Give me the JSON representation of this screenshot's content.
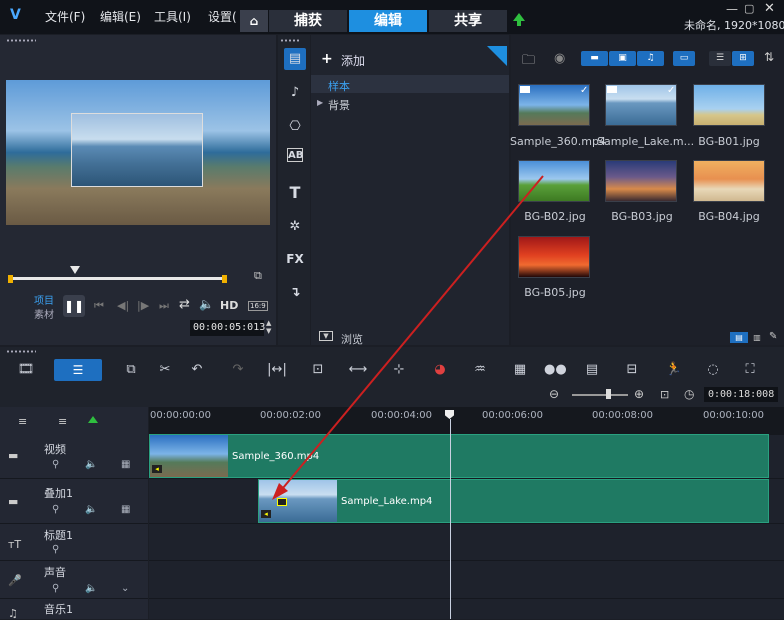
{
  "menu": {
    "file": "文件(F)",
    "edit": "编辑(E)",
    "tools": "工具(I)",
    "settings": "设置(S)"
  },
  "tabs": {
    "capture": "捕获",
    "edit": "编辑",
    "share": "共享"
  },
  "project_info": "未命名, 1920*1080",
  "player": {
    "project_label": "项目",
    "material_label": "素材",
    "hd_label": "HD",
    "aspect_label": "16:9",
    "timecode": "00:00:05:013"
  },
  "library": {
    "add_label": "添加",
    "tree": [
      "样本",
      "背景"
    ],
    "browse_label": "浏览",
    "media": [
      {
        "name": "Sample_360.mp4",
        "checked": true
      },
      {
        "name": "Sample_Lake.m...",
        "checked": true
      },
      {
        "name": "BG-B01.jpg",
        "checked": false
      },
      {
        "name": "BG-B02.jpg",
        "checked": false
      },
      {
        "name": "BG-B03.jpg",
        "checked": false
      },
      {
        "name": "BG-B04.jpg",
        "checked": false
      },
      {
        "name": "BG-B05.jpg",
        "checked": false
      }
    ]
  },
  "sidebar_icons": [
    "media-icon",
    "audio-icon",
    "transition-icon",
    "title-icon",
    "text-icon",
    "graphics-icon",
    "fx-icon",
    "path-icon"
  ],
  "sidebar_labels": {
    "title": "AB",
    "text": "T",
    "fx": "FX"
  },
  "timeline": {
    "duration": "0:00:18:008",
    "ruler": [
      "00:00:00:00",
      "00:00:02:00",
      "00:00:04:00",
      "00:00:06:00",
      "00:00:08:00",
      "00:00:10:00"
    ],
    "tracks": [
      {
        "name": "视频",
        "clip": "Sample_360.mp4"
      },
      {
        "name": "叠加1",
        "clip": "Sample_Lake.mp4"
      },
      {
        "name": "标题1",
        "clip": ""
      },
      {
        "name": "声音",
        "clip": ""
      },
      {
        "name": "音乐1",
        "clip": ""
      }
    ]
  },
  "colors": {
    "accent": "#1e8fe0",
    "clip": "#1f7a63",
    "arrow": "#cc2020",
    "share_icon": "#2fbf3f"
  }
}
